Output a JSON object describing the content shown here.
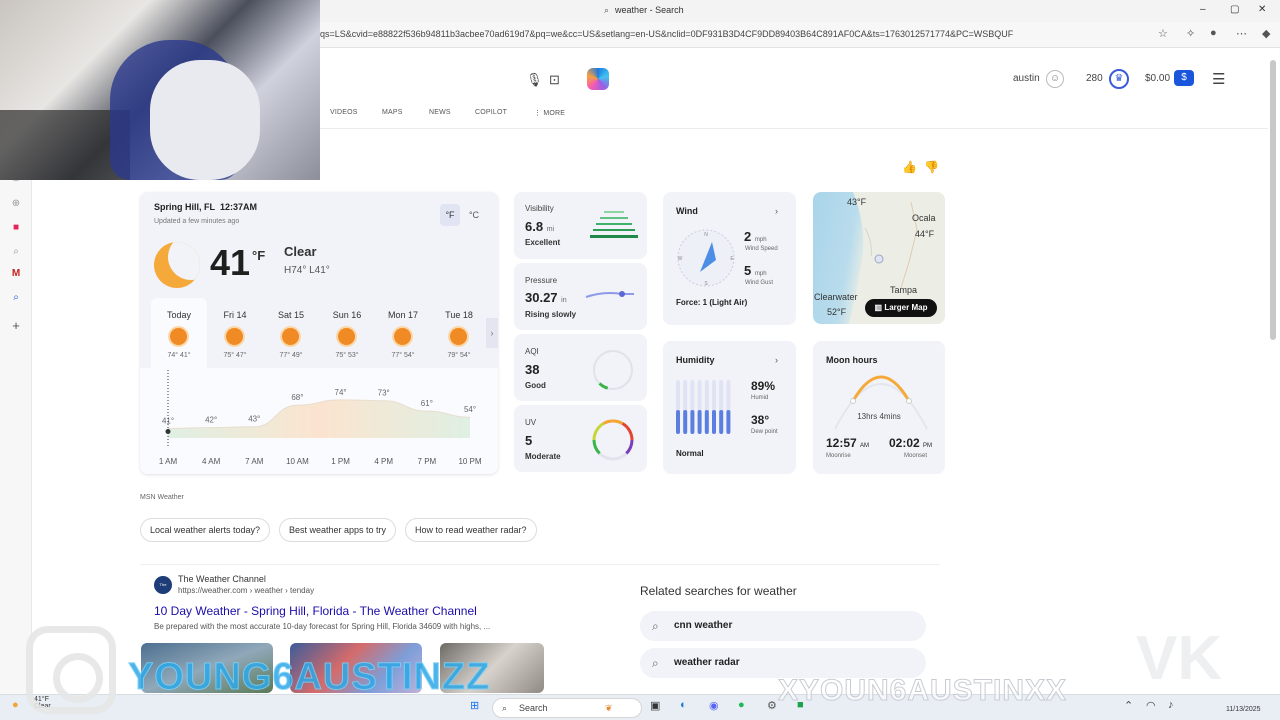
{
  "browser": {
    "title": "weather - Search",
    "url": "qs=LS&cvid=e88822f536b94811b3acbee70ad619d7&pq=we&cc=US&setlang=en-US&nclid=0DF931B3D4CF9DD89403B64C891AF0CA&ts=1763012571774&PC=WSBQUF",
    "win_min": "–",
    "win_max": "▢",
    "win_close": "✕"
  },
  "header": {
    "user_name": "austin",
    "rewards_points": "280",
    "wallet_amount": "$0.00",
    "wallet_symbol": "$",
    "tabs": [
      "VIDEOS",
      "MAPS",
      "NEWS",
      "COPILOT",
      "⋮ MORE"
    ]
  },
  "weather": {
    "location": "Spring Hill, FL",
    "time": "12:37AM",
    "updated": "Updated a few minutes ago",
    "unit_f": "°F",
    "unit_c": "°C",
    "temperature": "41",
    "temp_unit": "°F",
    "condition": "Clear",
    "hilo": "H74° L41°",
    "days": [
      {
        "name": "Today",
        "range": "74° 41°"
      },
      {
        "name": "Fri 14",
        "range": "75° 47°"
      },
      {
        "name": "Sat 15",
        "range": "77° 49°"
      },
      {
        "name": "Sun 16",
        "range": "75° 53°"
      },
      {
        "name": "Mon 17",
        "range": "77° 54°"
      },
      {
        "name": "Tue 18",
        "range": "79° 54°"
      }
    ],
    "source": "MSN Weather"
  },
  "chart_data": {
    "type": "area",
    "categories": [
      "1 AM",
      "4 AM",
      "7 AM",
      "10 AM",
      "1 PM",
      "4 PM",
      "7 PM",
      "10 PM"
    ],
    "values": [
      41,
      42,
      43,
      68,
      74,
      73,
      61,
      54
    ],
    "value_labels": [
      "41°",
      "42°",
      "43°",
      "68°",
      "74°",
      "73°",
      "61°",
      "54°"
    ],
    "ylim": [
      30,
      90
    ],
    "grid": false,
    "legend": "none"
  },
  "visibility": {
    "label": "Visibility",
    "value": "6.8",
    "unit": "mi",
    "desc": "Excellent"
  },
  "pressure": {
    "label": "Pressure",
    "value": "30.27",
    "unit": "in",
    "desc": "Rising slowly"
  },
  "aqi": {
    "label": "AQI",
    "value": "38",
    "desc": "Good",
    "level": 0.08
  },
  "uv": {
    "label": "UV",
    "value": "5",
    "desc": "Moderate",
    "level": 0.45
  },
  "wind": {
    "title": "Wind",
    "chevron": "›",
    "speed": "2",
    "speed_unit": "mph",
    "speed_label": "Wind Speed",
    "gust": "5",
    "gust_unit": "mph",
    "gust_label": "Wind Gust",
    "force": "Force: 1 (Light Air)",
    "dir_n": "N",
    "dir_e": "E",
    "dir_s": "S",
    "dir_w": "W"
  },
  "humidity": {
    "title": "Humidity",
    "chevron": "›",
    "value": "89%",
    "value_label": "Humid",
    "dew": "38°",
    "dew_label": "Dew point",
    "desc": "Normal",
    "level": 0.89
  },
  "map": {
    "label_north_temp": "43°F",
    "city1": "Ocala",
    "city1_temp": "44°F",
    "city2": "Tampa",
    "city3": "Clearwater",
    "city3_temp": "52°F",
    "button": "Larger Map"
  },
  "moon": {
    "title": "Moon hours",
    "duration": "13hrs 4mins",
    "moonrise": "12:57",
    "moonrise_ampm": "AM",
    "moonrise_label": "Moonrise",
    "moonset": "02:02",
    "moonset_ampm": "PM",
    "moonset_label": "Moonset"
  },
  "chips": [
    "Local weather alerts today?",
    "Best weather apps to try",
    "How to read weather radar?"
  ],
  "result": {
    "site": "The Weather Channel",
    "favicon_text": "The Weather Channel",
    "url": "https://weather.com › weather › tenday",
    "title": "10 Day Weather - Spring Hill, Florida - The Weather Channel",
    "desc": "Be prepared with the most accurate 10-day forecast for Spring Hill, Florida 34609 with highs, ..."
  },
  "related": {
    "title": "Related searches for weather",
    "items": [
      "cnn weather",
      "weather radar"
    ]
  },
  "taskbar": {
    "search": "Search",
    "weather_temp": "41°F",
    "weather_cond": "Clear",
    "date": "11/13/2025"
  },
  "overlay": {
    "watermark_left": "YOUNG6AUSTINZZ",
    "watermark_right": "XYOUN6AUSTINXX",
    "vk_logo": "VK"
  },
  "colors": {
    "accent_blue": "#1a56db",
    "sun_orange": "#f08a24",
    "link": "#1a0dab"
  }
}
